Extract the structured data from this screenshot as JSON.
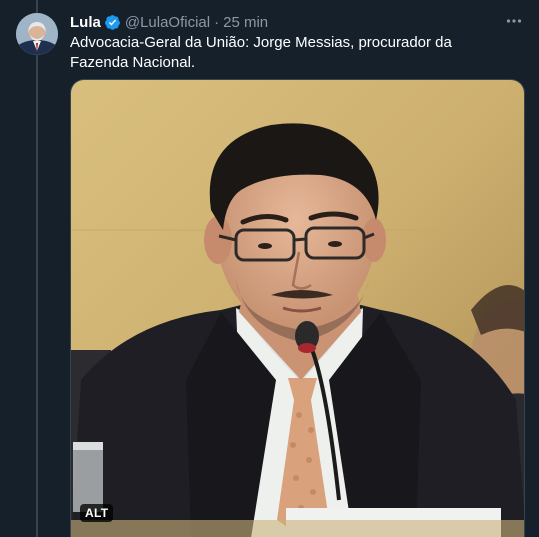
{
  "tweet": {
    "display_name": "Lula",
    "handle": "@LulaOficial",
    "separator": "·",
    "timestamp": "25 min",
    "text": "Advocacia-Geral da União: Jorge Messias, procurador da Fazenda Nacional.",
    "verified": true,
    "media": {
      "alt_badge": "ALT"
    }
  },
  "icons": {
    "verified": "verified-badge-icon",
    "more": "more-dots-icon"
  },
  "colors": {
    "background": "#15202b",
    "secondary_text": "#8b98a5",
    "verified_blue": "#1d9bf0",
    "thread_line": "#38444d"
  }
}
